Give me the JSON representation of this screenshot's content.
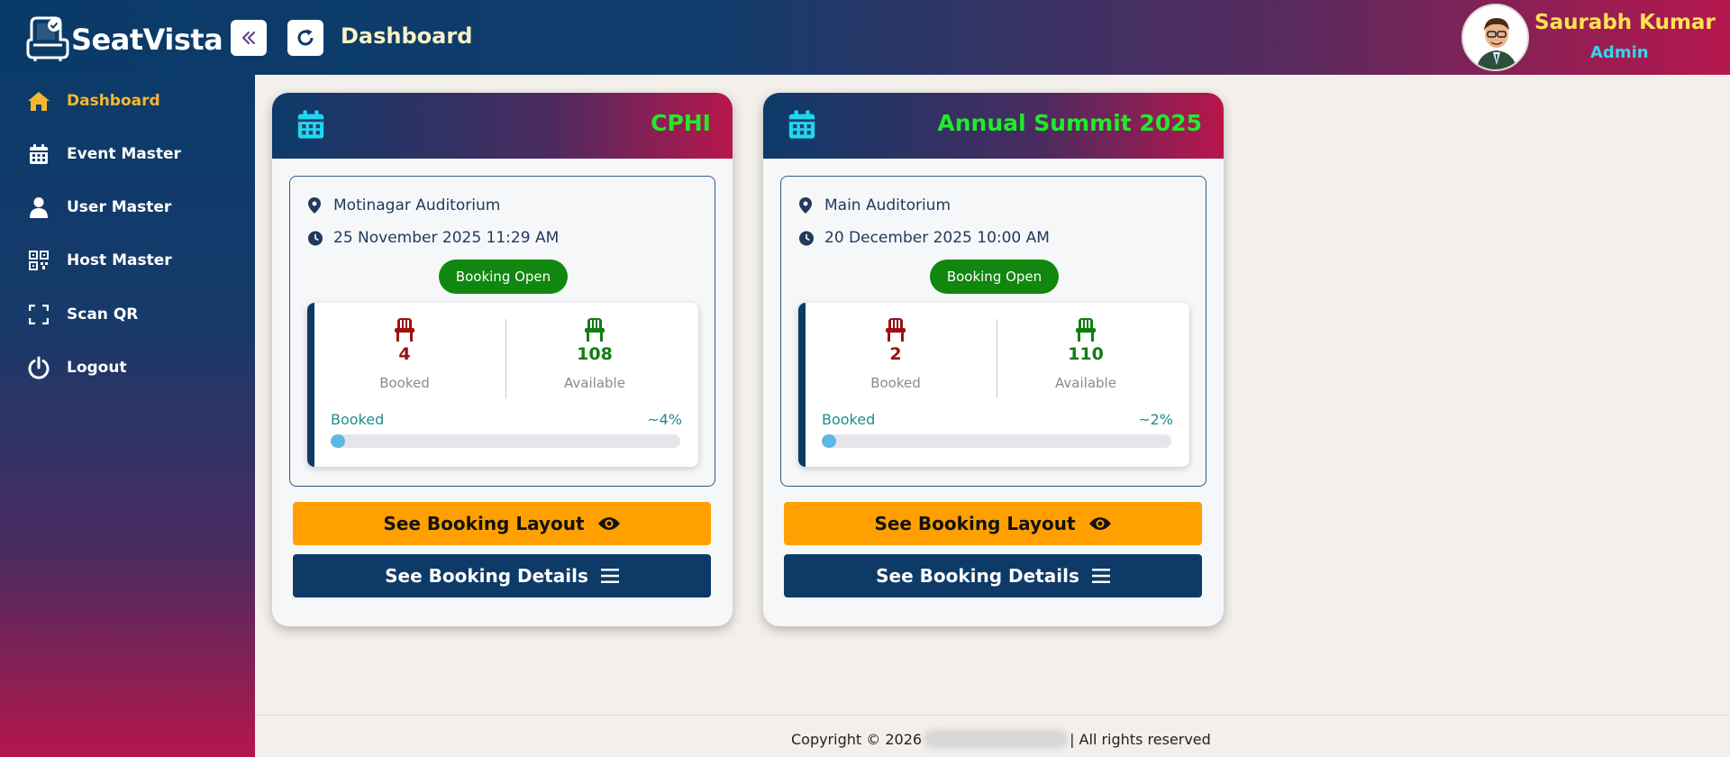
{
  "app": {
    "name": "SeatVista",
    "page_title": "Dashboard"
  },
  "user": {
    "name": "Saurabh Kumar",
    "role": "Admin"
  },
  "sidebar": {
    "items": [
      {
        "label": "Dashboard",
        "icon": "home-icon",
        "active": true
      },
      {
        "label": "Event Master",
        "icon": "calendar-icon",
        "active": false
      },
      {
        "label": "User Master",
        "icon": "user-icon",
        "active": false
      },
      {
        "label": "Host Master",
        "icon": "qr-code-icon",
        "active": false
      },
      {
        "label": "Scan QR",
        "icon": "scan-icon",
        "active": false
      },
      {
        "label": "Logout",
        "icon": "power-icon",
        "active": false
      }
    ]
  },
  "events": [
    {
      "title": "CPHI",
      "venue": "Motinagar Auditorium",
      "datetime": "25 November 2025 11:29 AM",
      "status": "Booking Open",
      "booked": "4",
      "booked_label": "Booked",
      "available": "108",
      "available_label": "Available",
      "progress_label": "Booked",
      "progress_pct": "~4%",
      "progress_fraction": 0.036,
      "layout_button": "See Booking Layout",
      "details_button": "See Booking Details"
    },
    {
      "title": "Annual Summit 2025",
      "venue": "Main Auditorium",
      "datetime": "20 December 2025 10:00 AM",
      "status": "Booking Open",
      "booked": "2",
      "booked_label": "Booked",
      "available": "110",
      "available_label": "Available",
      "progress_label": "Booked",
      "progress_pct": "~2%",
      "progress_fraction": 0.018,
      "layout_button": "See Booking Layout",
      "details_button": "See Booking Details"
    }
  ],
  "footer": {
    "copyright_prefix": "Copyright © 2026",
    "copyright_suffix": "| All rights reserved"
  },
  "colors": {
    "accent": "#f5b731",
    "booked": "#9d1010",
    "available": "#0f7d12",
    "badge": "#10870f",
    "layout_btn": "#ffa000",
    "details_btn": "#0e3a67"
  }
}
